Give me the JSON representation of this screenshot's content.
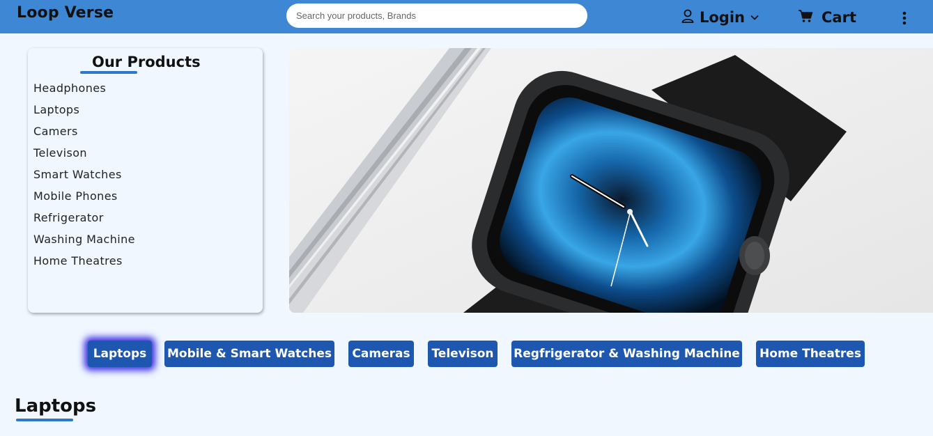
{
  "header": {
    "brand": "Loop Verse",
    "search_placeholder": "Search your products, Brands",
    "login_label": "Login",
    "cart_label": "Cart"
  },
  "sidebar": {
    "title": "Our Products",
    "items": [
      {
        "label": "Headphones"
      },
      {
        "label": "Laptops"
      },
      {
        "label": "Camers"
      },
      {
        "label": "Televison"
      },
      {
        "label": "Smart Watches"
      },
      {
        "label": "Mobile Phones"
      },
      {
        "label": "Refrigerator"
      },
      {
        "label": "Washing Machine"
      },
      {
        "label": "Home Theatres"
      }
    ]
  },
  "categories": [
    {
      "label": "Laptops",
      "active": true
    },
    {
      "label": "Mobile & Smart Watches"
    },
    {
      "label": "Cameras"
    },
    {
      "label": "Televison"
    },
    {
      "label": "Regfrigerator & Washing Machine"
    },
    {
      "label": "Home Theatres"
    }
  ],
  "section": {
    "title": "Laptops"
  },
  "colors": {
    "header_bg": "#3d87d4",
    "page_bg": "#f0f7ff",
    "button_bg": "#1d57b0",
    "accent_underline": "#2f78c8"
  },
  "icons": {
    "login": "user-icon",
    "login_dropdown": "chevron-down-icon",
    "cart": "cart-icon",
    "menu": "kebab-menu-icon"
  }
}
